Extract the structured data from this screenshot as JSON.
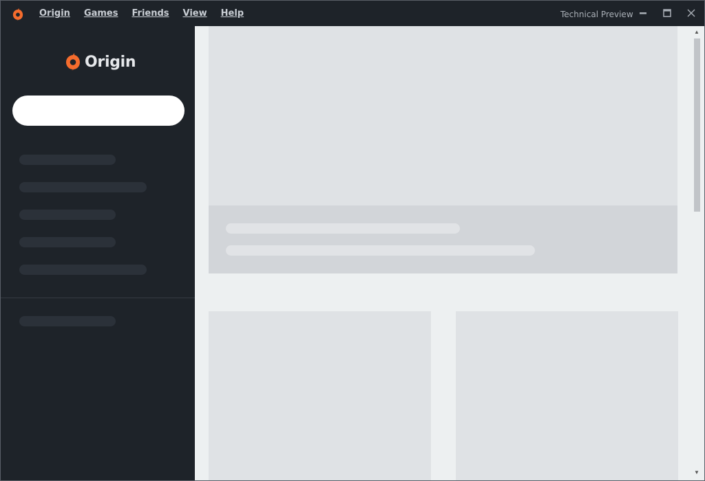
{
  "titlebar": {
    "menu": [
      {
        "label": "Origin"
      },
      {
        "label": "Games"
      },
      {
        "label": "Friends"
      },
      {
        "label": "View"
      },
      {
        "label": "Help"
      }
    ],
    "status_text": "Technical Preview",
    "icons": {
      "app": "origin-logo-icon",
      "minimize": "minimize-icon",
      "maximize": "maximize-icon",
      "close": "close-icon"
    }
  },
  "sidebar": {
    "brand_name": "Origin",
    "search": {
      "value": "",
      "placeholder": ""
    },
    "nav_placeholder_count": 6
  },
  "colors": {
    "brand_orange": "#f56c2d",
    "sidebar_bg": "#1e2329",
    "content_bg": "#edf0f1",
    "placeholder_dark": "#2b3139",
    "placeholder_light": "#dfe2e5"
  }
}
